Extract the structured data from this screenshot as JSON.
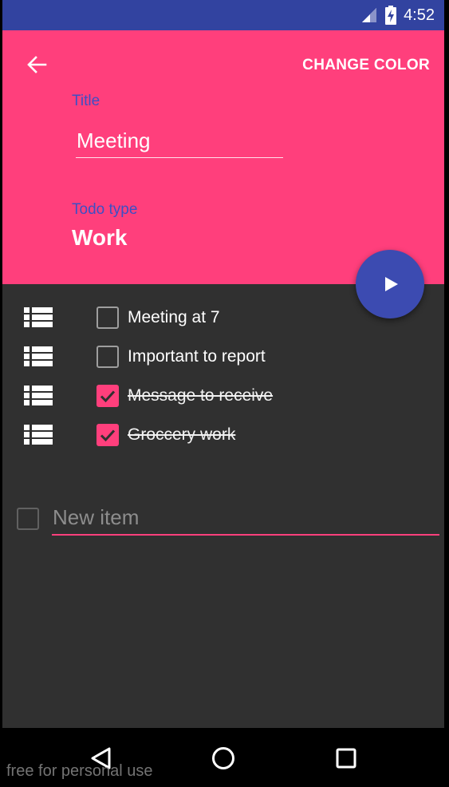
{
  "status_bar": {
    "time": "4:52",
    "icons": [
      "signal-icon",
      "battery-charging-icon"
    ]
  },
  "header": {
    "back_icon": "arrow-back-icon",
    "change_color_label": "CHANGE COLOR",
    "title_label": "Title",
    "title_value": "Meeting",
    "todo_type_label": "Todo type",
    "todo_type_value": "Work",
    "background_color": "#ff3f7c",
    "label_color": "#3d4fc4"
  },
  "fab": {
    "icon": "play-icon",
    "color": "#3c4bb1"
  },
  "todos": [
    {
      "text": "Meeting at 7",
      "checked": false
    },
    {
      "text": "Important to report",
      "checked": false
    },
    {
      "text": "Message to receive",
      "checked": true
    },
    {
      "text": "Groccery work",
      "checked": true
    }
  ],
  "new_item": {
    "placeholder": "New item",
    "value": ""
  },
  "nav_bar": {
    "icons": [
      "back-triangle-icon",
      "home-circle-icon",
      "recents-square-icon"
    ]
  },
  "watermark": "free for personal use",
  "colors": {
    "accent": "#ff3f7c",
    "primary": "#3243a0",
    "surface": "#303030"
  }
}
